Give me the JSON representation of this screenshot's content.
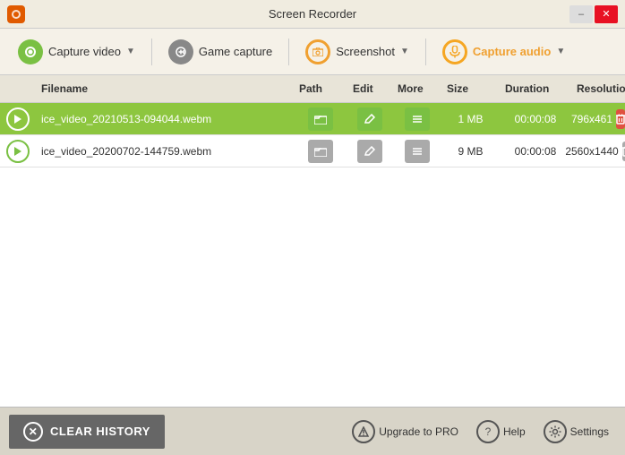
{
  "titlebar": {
    "title": "Screen Recorder",
    "icon": "🟠",
    "minimize_label": "–",
    "close_label": "✕"
  },
  "toolbar": {
    "capture_video_label": "Capture video",
    "game_capture_label": "Game capture",
    "screenshot_label": "Screenshot",
    "capture_audio_label": "Capture audio"
  },
  "table": {
    "headers": {
      "play": "",
      "filename": "Filename",
      "path": "Path",
      "edit": "Edit",
      "more": "More",
      "size": "Size",
      "duration": "Duration",
      "resolution": "Resolution"
    },
    "rows": [
      {
        "filename": "ice_video_20210513-094044.webm",
        "size": "1 MB",
        "duration": "00:00:08",
        "resolution": "796x461",
        "highlighted": true
      },
      {
        "filename": "ice_video_20200702-144759.webm",
        "size": "9 MB",
        "duration": "00:00:08",
        "resolution": "2560x1440",
        "highlighted": false
      }
    ]
  },
  "footer": {
    "clear_history_label": "CLEAR HISTORY",
    "upgrade_label": "Upgrade to PRO",
    "help_label": "Help",
    "settings_label": "Settings"
  }
}
